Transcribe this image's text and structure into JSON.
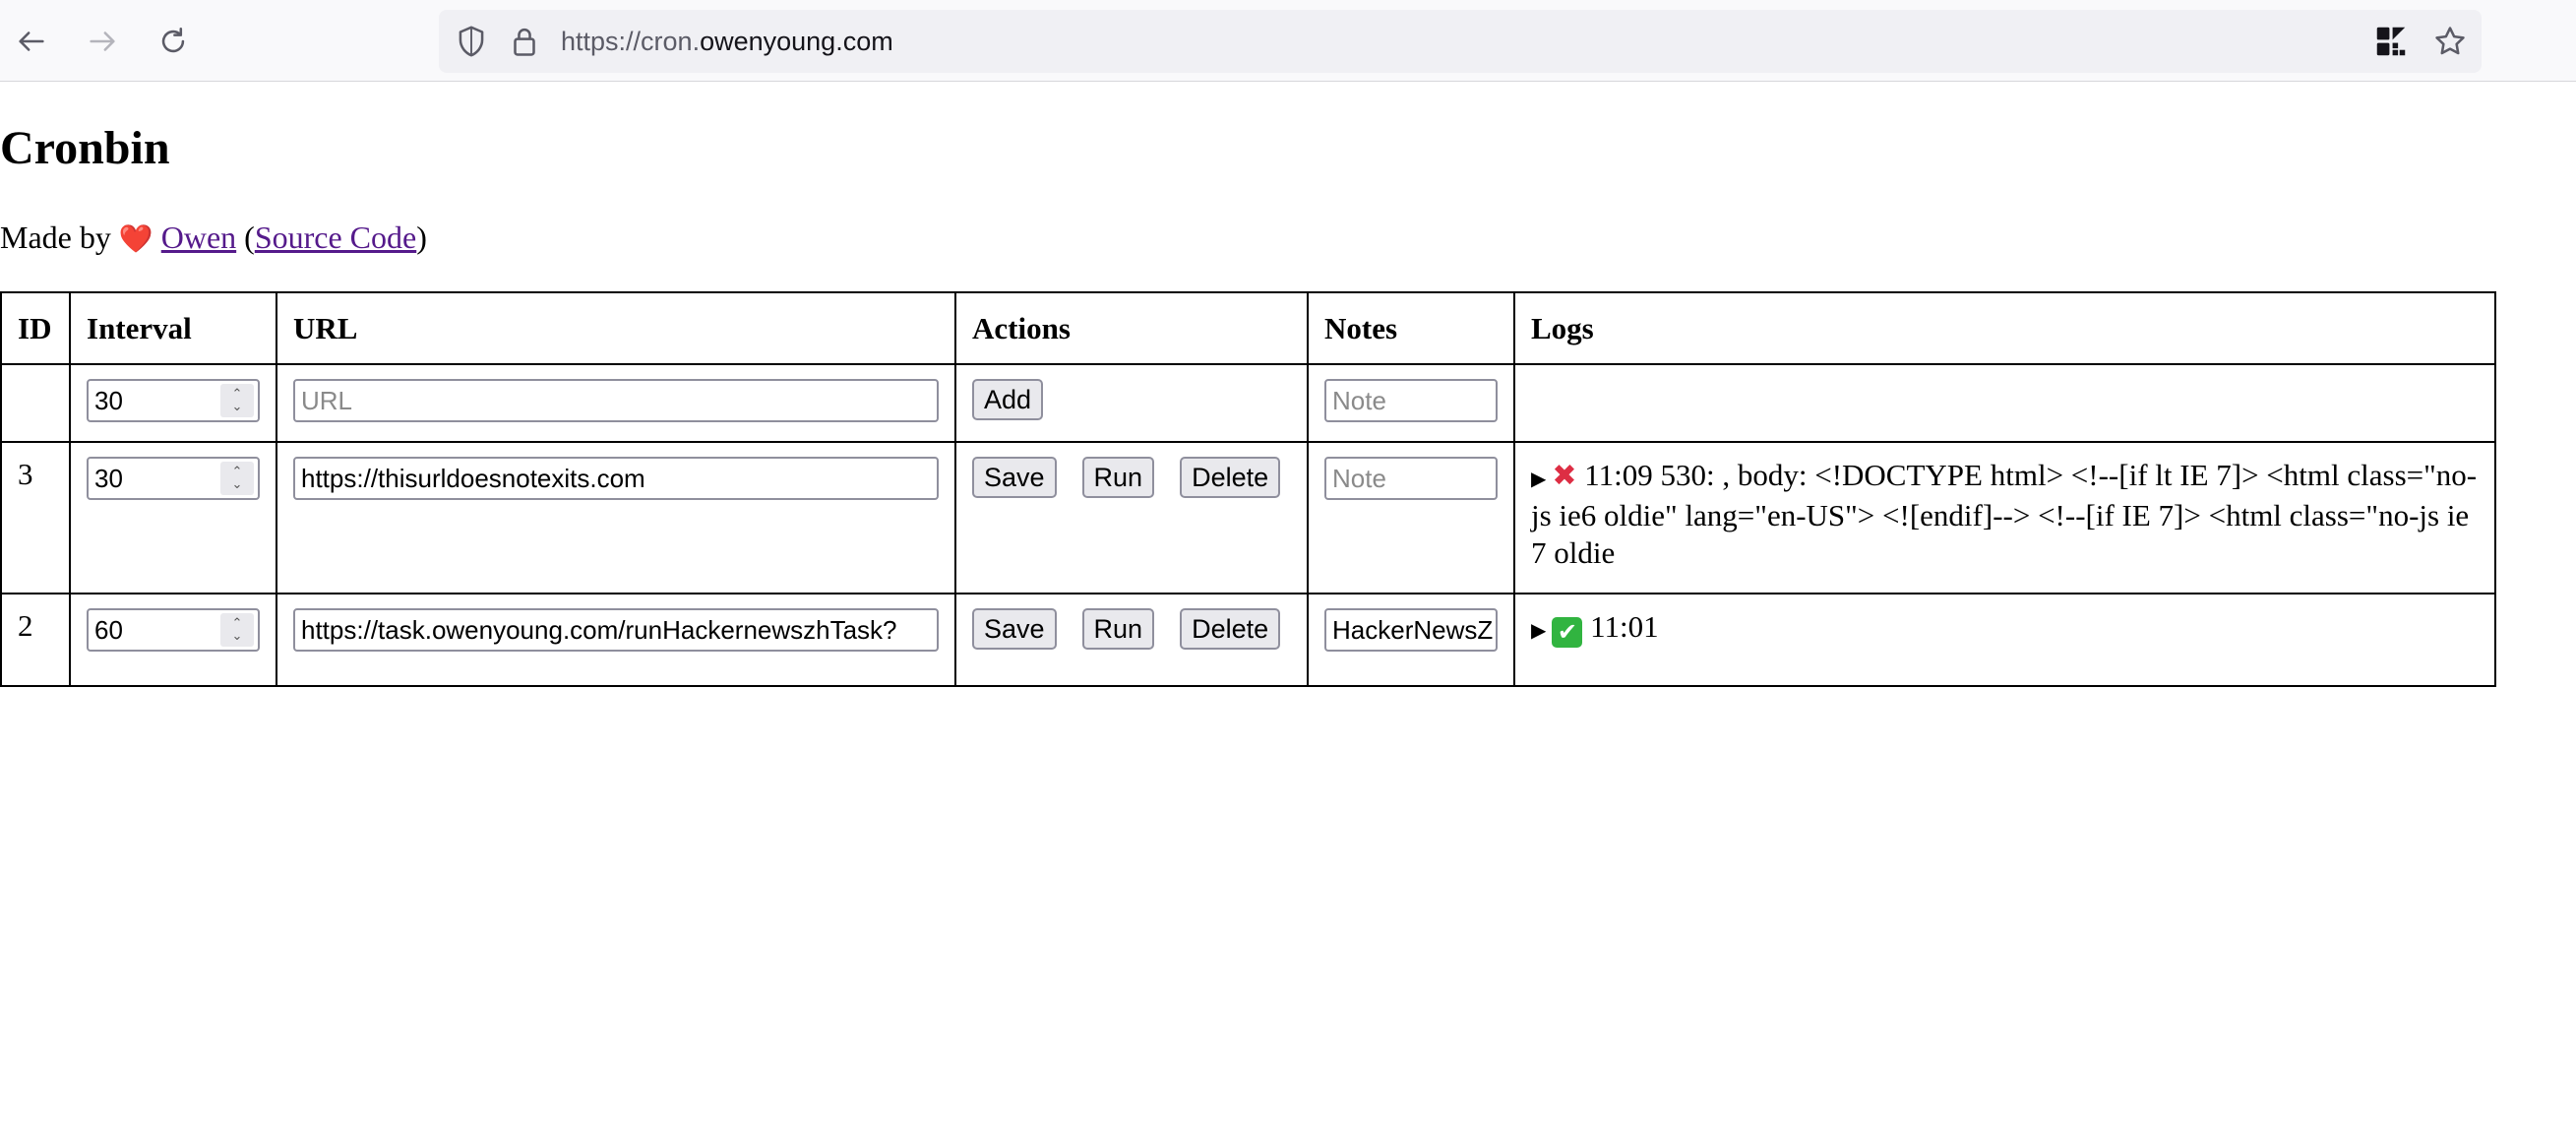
{
  "browser": {
    "url_prefix": "https://cron.",
    "url_domain": "owenyoung.com"
  },
  "page": {
    "title": "Cronbin",
    "made_by_prefix": "Made by",
    "author_link": "Owen",
    "open_paren": "(",
    "source_link": "Source Code",
    "close_paren": ")"
  },
  "table": {
    "headers": {
      "id": "ID",
      "interval": "Interval",
      "url": "URL",
      "actions": "Actions",
      "notes": "Notes",
      "logs": "Logs"
    },
    "add_row": {
      "interval_value": "30",
      "url_placeholder": "URL",
      "add_label": "Add",
      "note_placeholder": "Note"
    },
    "rows": [
      {
        "id": "3",
        "interval": "30",
        "url": "https://thisurldoesnotexits.com",
        "save_label": "Save",
        "run_label": "Run",
        "delete_label": "Delete",
        "note": "",
        "note_placeholder": "Note",
        "log_time": "11:09",
        "log_text": "530: , body: <!DOCTYPE html> <!--[if lt IE 7]> <html class=\"no-js ie6 oldie\" lang=\"en-US\"> <![endif]--> <!--[if IE 7]> <html class=\"no-js ie7 oldie",
        "log_status": "error"
      },
      {
        "id": "2",
        "interval": "60",
        "url": "https://task.owenyoung.com/runHackernewszhTask?",
        "save_label": "Save",
        "run_label": "Run",
        "delete_label": "Delete",
        "note": "HackerNewsZ",
        "note_placeholder": "Note",
        "log_time": "11:01",
        "log_status": "success"
      }
    ]
  },
  "icons": {
    "back": "arrow-left-icon",
    "forward": "arrow-right-icon",
    "reload": "reload-icon",
    "tracking": "shield-icon",
    "lock": "lock-icon",
    "qr": "qr-code-icon",
    "bookmark": "star-icon",
    "heart": "heart-icon",
    "error": "cross-mark-icon",
    "success": "check-mark-icon"
  },
  "colors": {
    "link_visited": "#551a8b",
    "error_red": "#dd2e44",
    "success_green": "#31b440"
  }
}
